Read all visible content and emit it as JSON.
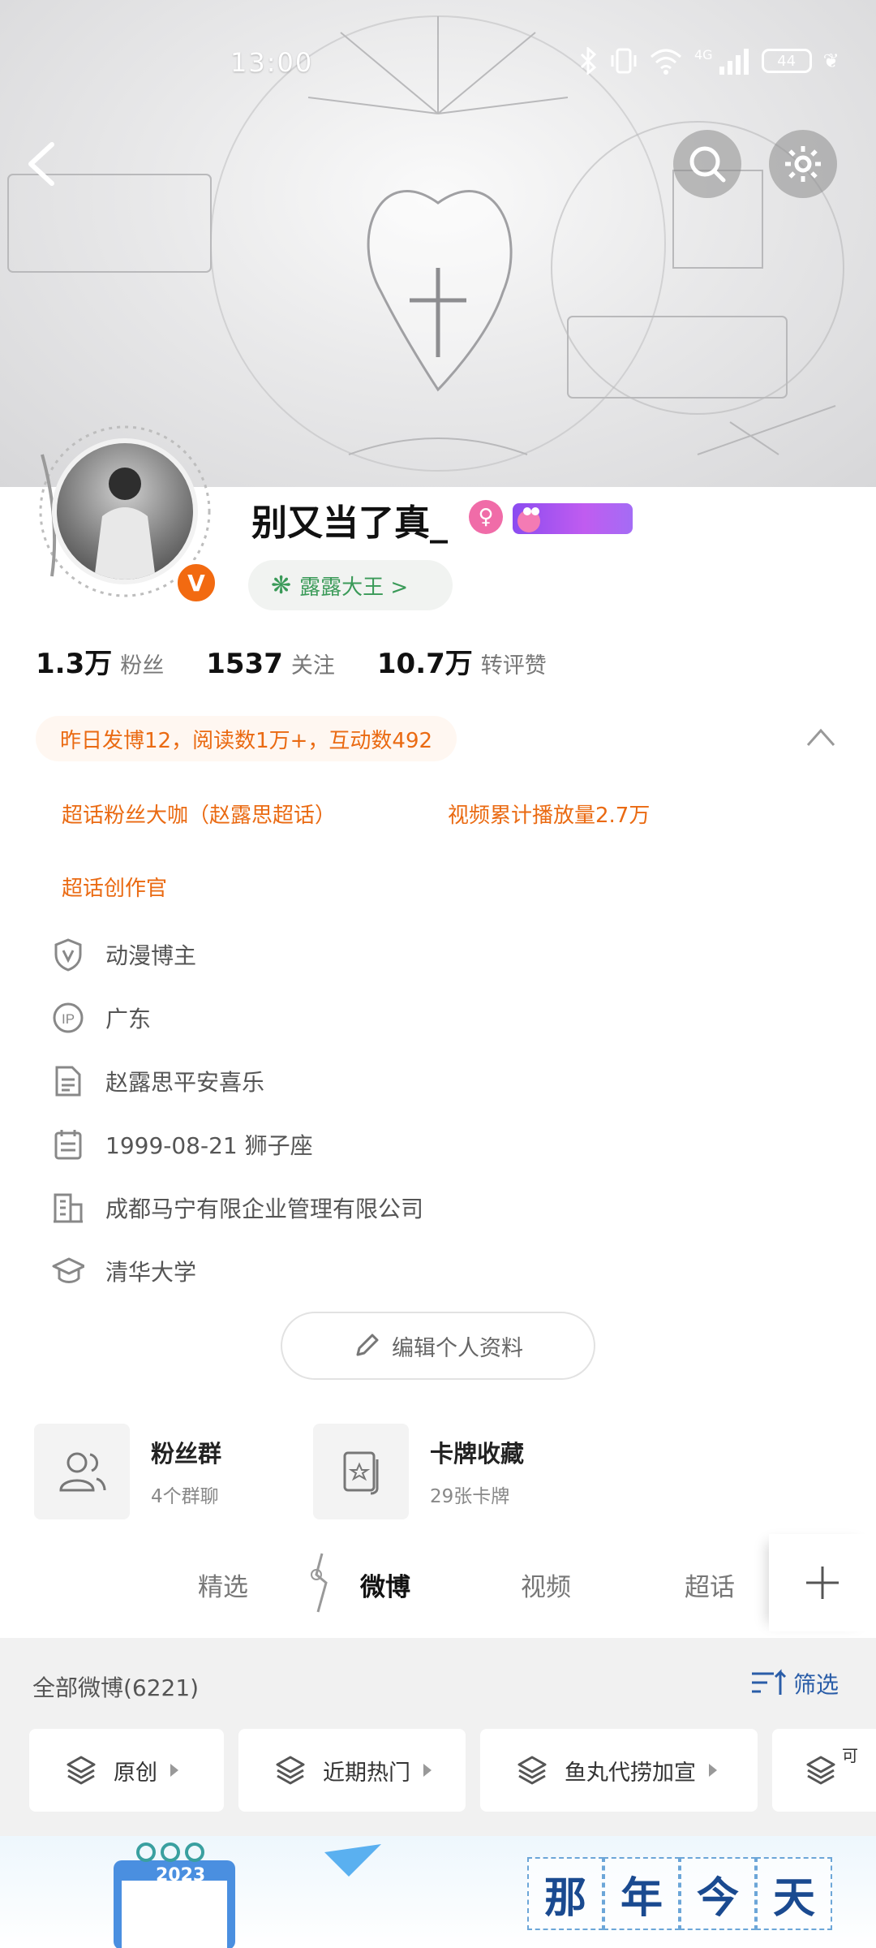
{
  "status_bar": {
    "time": "13:00",
    "network": "4G",
    "battery": "44"
  },
  "profile": {
    "username": "别又当了真_",
    "gender_symbol": "♀",
    "fan_title": "露露大王 >",
    "verified_letter": "V"
  },
  "stats": [
    {
      "value": "1.3万",
      "label": "粉丝"
    },
    {
      "value": "1537",
      "label": "关注"
    },
    {
      "value": "10.7万",
      "label": "转评赞"
    }
  ],
  "highlights": {
    "summary": "昨日发博12，阅读数1万+，互动数492",
    "badges": [
      "超话粉丝大咖（赵露思超话）",
      "视频累计播放量2.7万",
      "超话创作官"
    ]
  },
  "info": [
    {
      "icon": "verified-shield-icon",
      "text": "动漫博主"
    },
    {
      "icon": "ip-location-icon",
      "text": "广东"
    },
    {
      "icon": "document-icon",
      "text": "赵露思平安喜乐"
    },
    {
      "icon": "calendar-icon",
      "text": "1999-08-21 狮子座"
    },
    {
      "icon": "company-icon",
      "text": "成都马宁有限企业管理有限公司"
    },
    {
      "icon": "graduation-cap-icon",
      "text": "清华大学"
    }
  ],
  "edit_button": "编辑个人资料",
  "cards": [
    {
      "icon": "users-icon",
      "title": "粉丝群",
      "subtitle": "4个群聊"
    },
    {
      "icon": "card-icon",
      "title": "卡牌收藏",
      "subtitle": "29张卡牌"
    }
  ],
  "tabs": [
    {
      "label": "精选",
      "active": false
    },
    {
      "label": "微博",
      "active": true
    },
    {
      "label": "视频",
      "active": false
    },
    {
      "label": "超话",
      "active": false
    }
  ],
  "posts_header": {
    "title": "全部微博(6221)",
    "filter_label": "筛选"
  },
  "filters": [
    "原创",
    "近期热门",
    "鱼丸代捞加宣",
    "可"
  ],
  "promo": {
    "year": "2023",
    "chars": [
      "那",
      "年",
      "今",
      "天"
    ]
  },
  "colors": {
    "accent_orange": "#ea6a12",
    "fan_green": "#3a9a58",
    "link_blue": "#2a5da8"
  }
}
